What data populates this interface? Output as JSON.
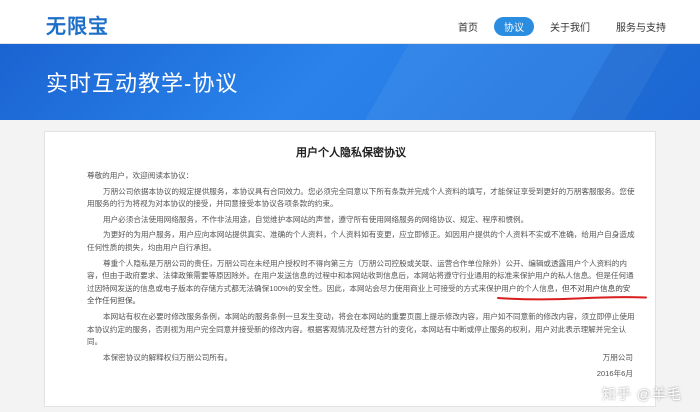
{
  "header": {
    "logo": "无限宝",
    "nav": [
      {
        "label": "首页",
        "active": false
      },
      {
        "label": "协议",
        "active": true
      },
      {
        "label": "关于我们",
        "active": false
      },
      {
        "label": "服务与支持",
        "active": false
      }
    ]
  },
  "banner": {
    "title": "实时互动教学-协议"
  },
  "document": {
    "title": "用户个人隐私保密协议",
    "paragraphs": [
      "尊敬的用户，欢迎阅读本协议：",
      "万朋公司依据本协议的规定提供服务，本协议具有合同效力。您必须完全同意以下所有条款并完成个人资料的填写，才能保证享受到更好的万朋客服服务。您使用服务的行为将视为对本协议的接受，并同意接受本协议各项条款的约束。",
      "用户必须合法使用网络服务，不作非法用途，自觉维护本网站的声誉，遵守所有使用网络服务的网络协议、规定、程序和惯例。",
      "为更好的为用户服务，用户应向本网站提供真实、准确的个人资料，个人资料如有变更，应立即修正。如因用户提供的个人资料不实或不准确，给用户自身造成任何性质的损失，均由用户自行承担。",
      "尊重个人隐私是万朋公司的责任，万朋公司在未经用户授权时不得向第三方（万朋公司控股或关联、运营合作单位除外）公开、编辑或透露用户个人资料的内容，但由于政府要求、法律政策需要等原因除外。在用户发送信息的过程中和本网站收到信息后，本网站将遵守行业通用的标准来保护用户的私人信息。但是任何通过因特网发送的信息或电子版本的存储方式都无法确保100%的安全性。因此，本网站会尽力使用商业上可接受的方式来保护用户的个人信息，",
      "本网站有权在必要时修改服务条例，本网站的服务条例一旦发生变动，将会在本网站的重要页面上提示修改内容，用户如不同意新的修改内容，须立即停止使用本协议约定的服务，否则视为用户完全同意并接受新的修改内容。根据客观情况及经营方针的变化，本网站有中断或停止服务的权利，用户对此表示理解并完全认同。",
      "本保密协议的解释权归万朋公司所有。"
    ],
    "highlight": "但不对用户信息的安全作任何担保。",
    "company": "万朋公司",
    "date": "2016年6月"
  },
  "watermark": "知乎 @羊毛",
  "colors": {
    "brand": "#1e6fc8",
    "banner": "#2a83ea",
    "nav_active": "#2b8de0",
    "annotation": "#d81e1e"
  }
}
